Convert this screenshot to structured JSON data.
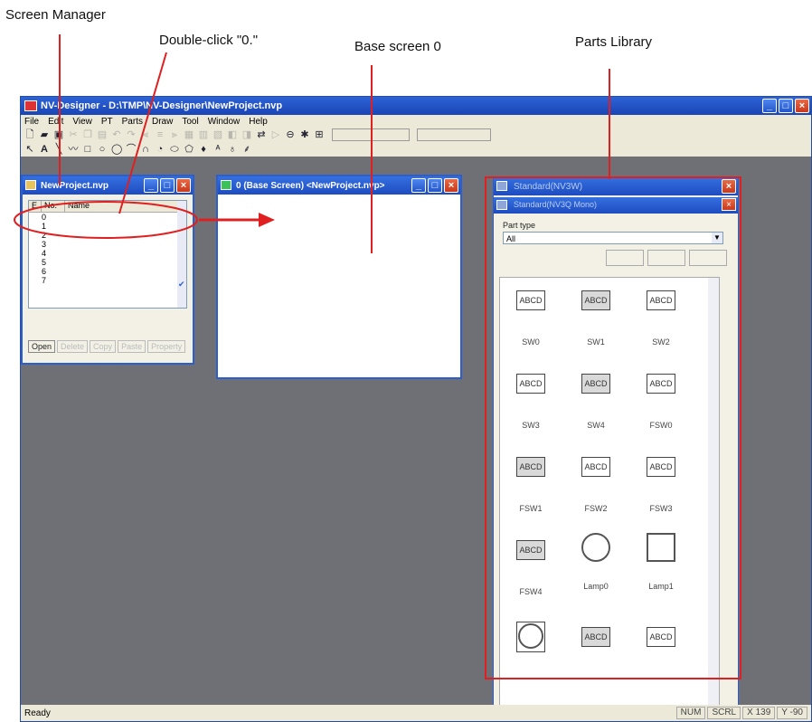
{
  "callouts": {
    "screen_manager": "Screen Manager",
    "double_click": "Double-click \"0.\"",
    "base_screen": "Base screen 0",
    "parts_library": "Parts Library"
  },
  "app": {
    "title": "NV-Designer - D:\\TMP\\NV-Designer\\NewProject.nvp",
    "menu": [
      "File",
      "Edit",
      "View",
      "PT",
      "Parts",
      "Draw",
      "Tool",
      "Window",
      "Help"
    ],
    "toolbar1": [
      "file-new-icon",
      "open-folder-icon",
      "save-icon"
    ],
    "toolbar2": [
      "select-arrow-icon",
      "text-A-icon",
      "line-icon",
      "polyline-icon",
      "rect-icon",
      "ellipse-icon",
      "arc-icon",
      "curve-icon",
      "polygon-icon",
      "circle-icon",
      "fill-icon",
      "paint-icon",
      "textstyle-icon",
      "bucket-icon",
      "hatch-icon"
    ],
    "status": {
      "left": "Ready",
      "num": "NUM",
      "scrl": "SCRL",
      "x": "X 139",
      "y": "Y -90"
    }
  },
  "screen_manager": {
    "title": "NewProject.nvp",
    "columns": [
      "E",
      "No.",
      "Name"
    ],
    "rows": [
      "0",
      "1",
      "2",
      "3",
      "4",
      "5",
      "6",
      "7"
    ],
    "buttons": [
      "Open",
      "Delete",
      "Copy",
      "Paste",
      "Property"
    ]
  },
  "base_screen": {
    "title": "0 (Base Screen) <NewProject.nvp>"
  },
  "parts_library": {
    "title1": "Standard(NV3W)",
    "title2": "Standard(NV3Q Mono)",
    "part_type_label": "Part type",
    "part_type_value": "All",
    "parts": [
      {
        "name": "SW0",
        "icon": "ABCD",
        "style": "plain"
      },
      {
        "name": "SW1",
        "icon": "ABCD",
        "style": "shade"
      },
      {
        "name": "SW2",
        "icon": "ABCD",
        "style": "plain"
      },
      {
        "name": "SW3",
        "icon": "ABCD",
        "style": "plain"
      },
      {
        "name": "SW4",
        "icon": "ABCD",
        "style": "shade"
      },
      {
        "name": "FSW0",
        "icon": "ABCD",
        "style": "plain"
      },
      {
        "name": "FSW1",
        "icon": "ABCD",
        "style": "shade"
      },
      {
        "name": "FSW2",
        "icon": "ABCD",
        "style": "plain"
      },
      {
        "name": "FSW3",
        "icon": "ABCD",
        "style": "plain"
      },
      {
        "name": "FSW4",
        "icon": "ABCD",
        "style": "shade"
      },
      {
        "name": "Lamp0",
        "icon": "",
        "style": "lamp-c"
      },
      {
        "name": "Lamp1",
        "icon": "",
        "style": "lamp-s"
      },
      {
        "name": "",
        "icon": "",
        "style": "frame"
      },
      {
        "name": "",
        "icon": "ABCD",
        "style": "shade"
      },
      {
        "name": "",
        "icon": "ABCD",
        "style": "plain"
      }
    ]
  },
  "colors": {
    "annotation": "#e02020",
    "title_bar": "#1e4cc0",
    "desktop": "#6e7076"
  }
}
